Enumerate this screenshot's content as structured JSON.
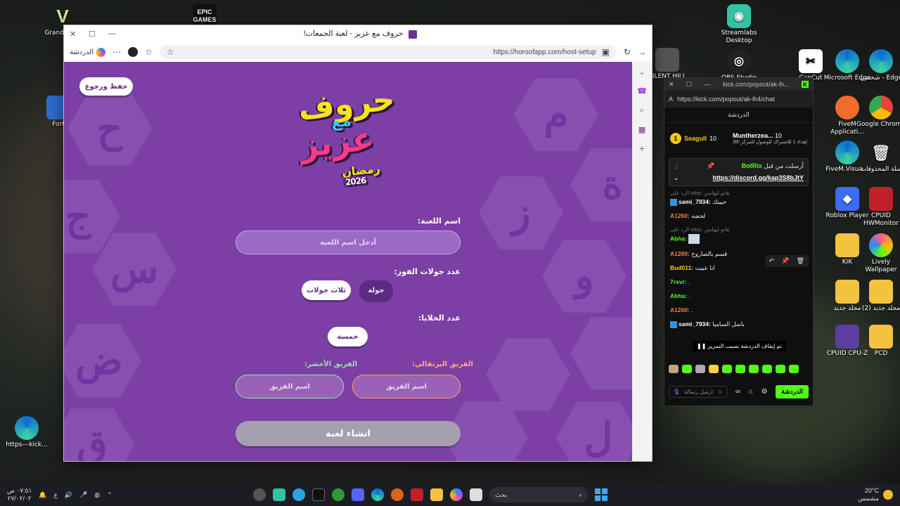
{
  "browser": {
    "title": "حروف مع عزيز - لعبة الجمعات!",
    "url": "https://horoofapp.com/host-setup",
    "chat_label": "الدردشة"
  },
  "page": {
    "save_back": "حفظ ورجوع",
    "logo_line1": "حروف",
    "logo_line2": "مع",
    "logo_line3": "عزيز",
    "logo_line4": "رمضان",
    "logo_year": "2026",
    "game_name_label": "اسم اللعبة:",
    "game_name_placeholder": "أدخل اسم اللعبة",
    "rounds_label": "عدد جولات الفوز:",
    "rounds_opt_three": "ثلاث جولات",
    "rounds_opt_one": "جولة",
    "cells_label": "عدد الخلايا:",
    "cells_opt": "خمسة",
    "team_orange_label": "الفريق البرتقالي:",
    "team_green_label": "الفريق الأخضر:",
    "team_placeholder": "اسم الفريق",
    "create_button": "انشاء لعبة",
    "hex_letters": [
      "ح",
      "ج",
      "س",
      "ض",
      "ق",
      "م",
      "ز",
      "ة",
      "و",
      "ل",
      "ق"
    ]
  },
  "chat": {
    "window_url_short": "kick.com/popout/ak-lh...",
    "url": "https://kick.com/popout/ak-lh4/chat",
    "header": "الدردشة",
    "leader_left_name": "Seagull",
    "leader_left_count": "10",
    "leader_right_name": "Muntherzea...",
    "leader_right_count": "10",
    "leader_right_sub": "إهداء 1 للاشتراك للوصول للمركز 3th",
    "pinned_by": "أرسلت من قبل",
    "pinned_user": "BotRix",
    "pinned_link": "https://discord.gg/kap3S8bJtY",
    "messages": [
      {
        "reply": "الرد على v8rp: هاتو ليهابس",
        "user": "sami_7934:",
        "text": "حبيتك",
        "color": "#ffffff"
      },
      {
        "reply": "",
        "user": "A1260:",
        "text": "لحضه",
        "color": "#ff7b3a"
      },
      {
        "reply": "الرد على v8rp: هاتو ليهابس",
        "user": "Abha:",
        "text": "",
        "color": "#53fc18"
      },
      {
        "reply": "",
        "user": "A1260:",
        "text": "قسم بالصاروخ",
        "color": "#ff7b3a"
      },
      {
        "reply": "",
        "user": "Bud011:",
        "text": "انا عبيت",
        "color": "#ffcc00"
      },
      {
        "reply": "",
        "user": "7rsvr:",
        "text": ".",
        "color": "#53fc18"
      },
      {
        "reply": "",
        "user": "Abha:",
        "text": ".",
        "color": "#53fc18"
      },
      {
        "reply": "",
        "user": "A1260:",
        "text": ".",
        "color": "#ff7b3a"
      },
      {
        "reply": "",
        "user": "sami_7934:",
        "text": "باسل الساميا",
        "color": "#ffffff"
      }
    ],
    "paused_notice": "تم إيقاف الدردشة بسبب التمرير",
    "input_placeholder": "ارسل رسالة",
    "send_label": "الدردشة"
  },
  "desktop": {
    "icons_left": [
      "Grand Auto",
      "EPIC GAMES",
      "Fort",
      "https---kick..."
    ],
    "icons_right": [
      "Streamlabs Desktop",
      "SILENT HILL",
      "OBS Studio",
      "CapCut",
      "Microsoft Edge",
      "شخصي - Edge",
      "FiveM Applicati...",
      "Google Chrome",
      "FiveM.Visua...",
      "سلة المحذوفات",
      "Roblox Player",
      "CPUID HWMonitor",
      "KIK",
      "Lively Wallpaper",
      "مجلد جديد",
      "(2) مجلد جديد",
      "CPUID CPU-Z",
      "PCD"
    ]
  },
  "taskbar": {
    "time": "٠٧:٥١ ص",
    "date": "٢٧/٠٢/٠٢",
    "lang": "ع",
    "search_placeholder": "بحث",
    "weather_temp": "20°C",
    "weather_text": "مشمس"
  }
}
